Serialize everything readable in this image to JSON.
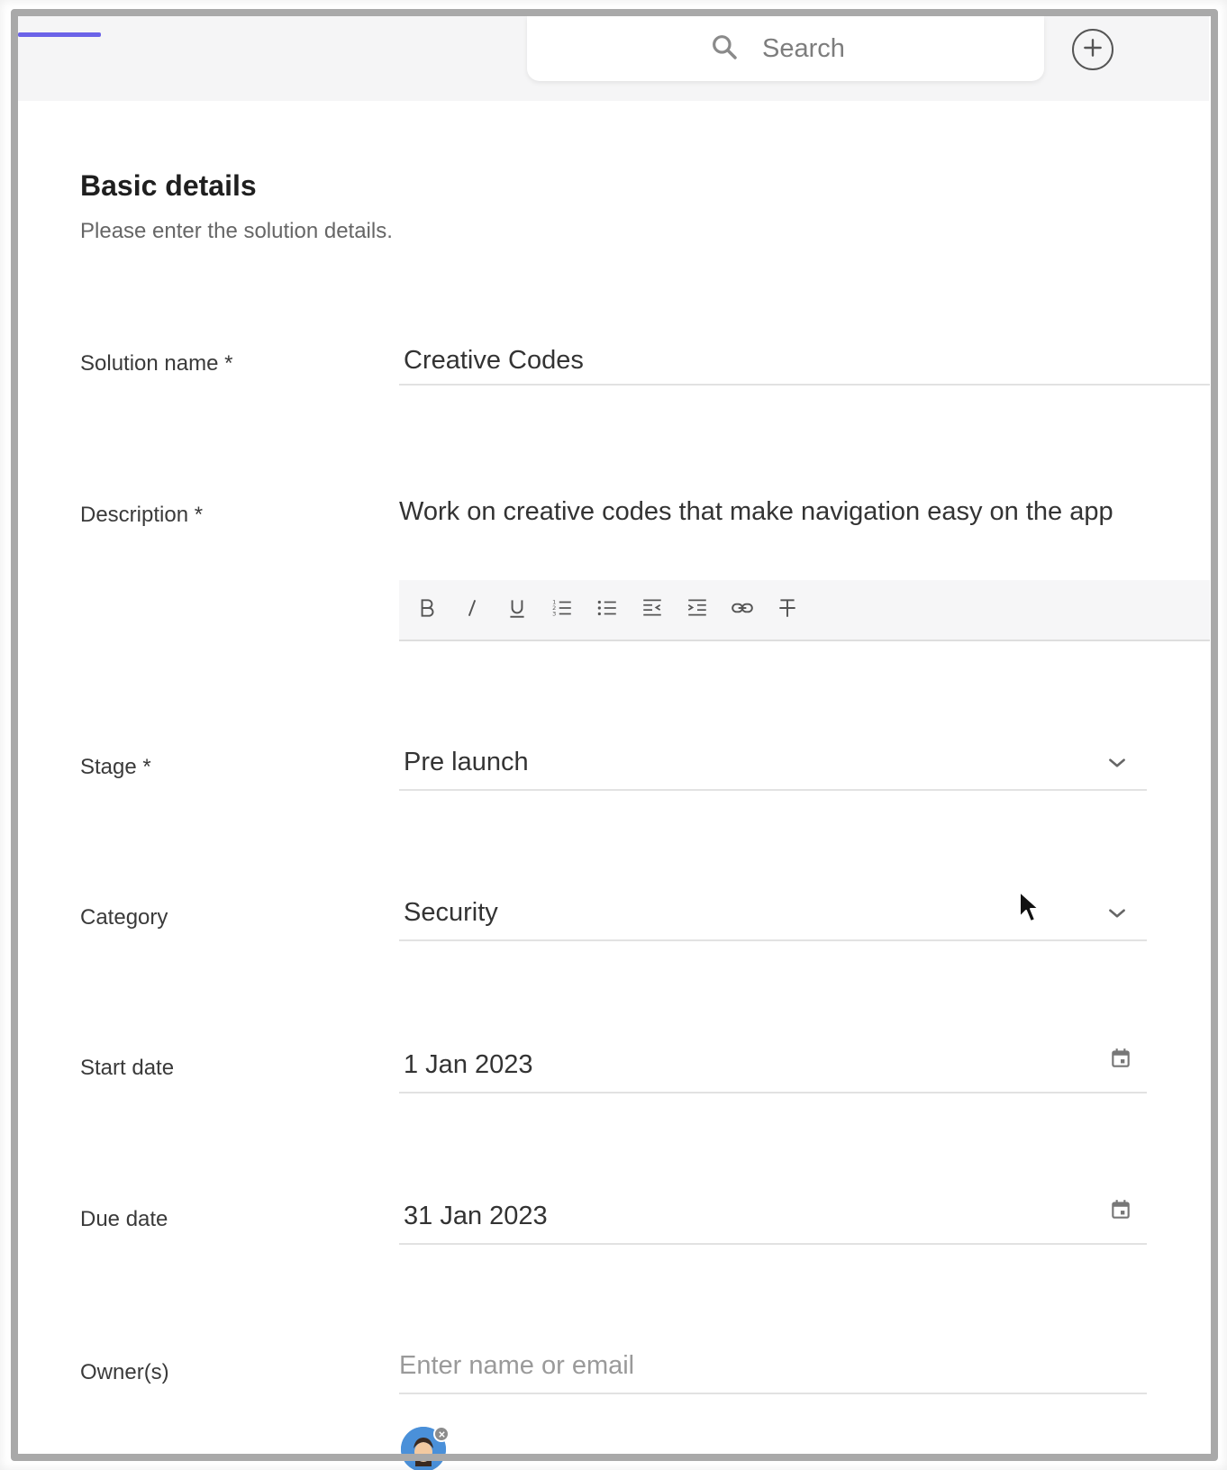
{
  "header": {
    "search": {
      "placeholder": "Search"
    },
    "add_icon": "plus-circle-icon",
    "accent_color": "#6b63e8"
  },
  "section": {
    "title": "Basic details",
    "subtitle": "Please enter the solution details."
  },
  "form": {
    "solution_name": {
      "label": "Solution name *",
      "value": "Creative Codes"
    },
    "description": {
      "label": "Description *",
      "value": "Work on creative codes that make navigation easy on the app",
      "toolbar": [
        "bold-icon",
        "italic-icon",
        "underline-icon",
        "ordered-list-icon",
        "bullet-list-icon",
        "outdent-icon",
        "indent-icon",
        "link-icon",
        "strikethrough-icon"
      ]
    },
    "stage": {
      "label": "Stage *",
      "value": "Pre launch"
    },
    "category": {
      "label": "Category",
      "value": "Security"
    },
    "start_date": {
      "label": "Start date",
      "value": "1 Jan 2023"
    },
    "due_date": {
      "label": "Due date",
      "value": "31 Jan 2023"
    },
    "owners": {
      "label": "Owner(s)",
      "placeholder": "Enter name or email"
    }
  }
}
